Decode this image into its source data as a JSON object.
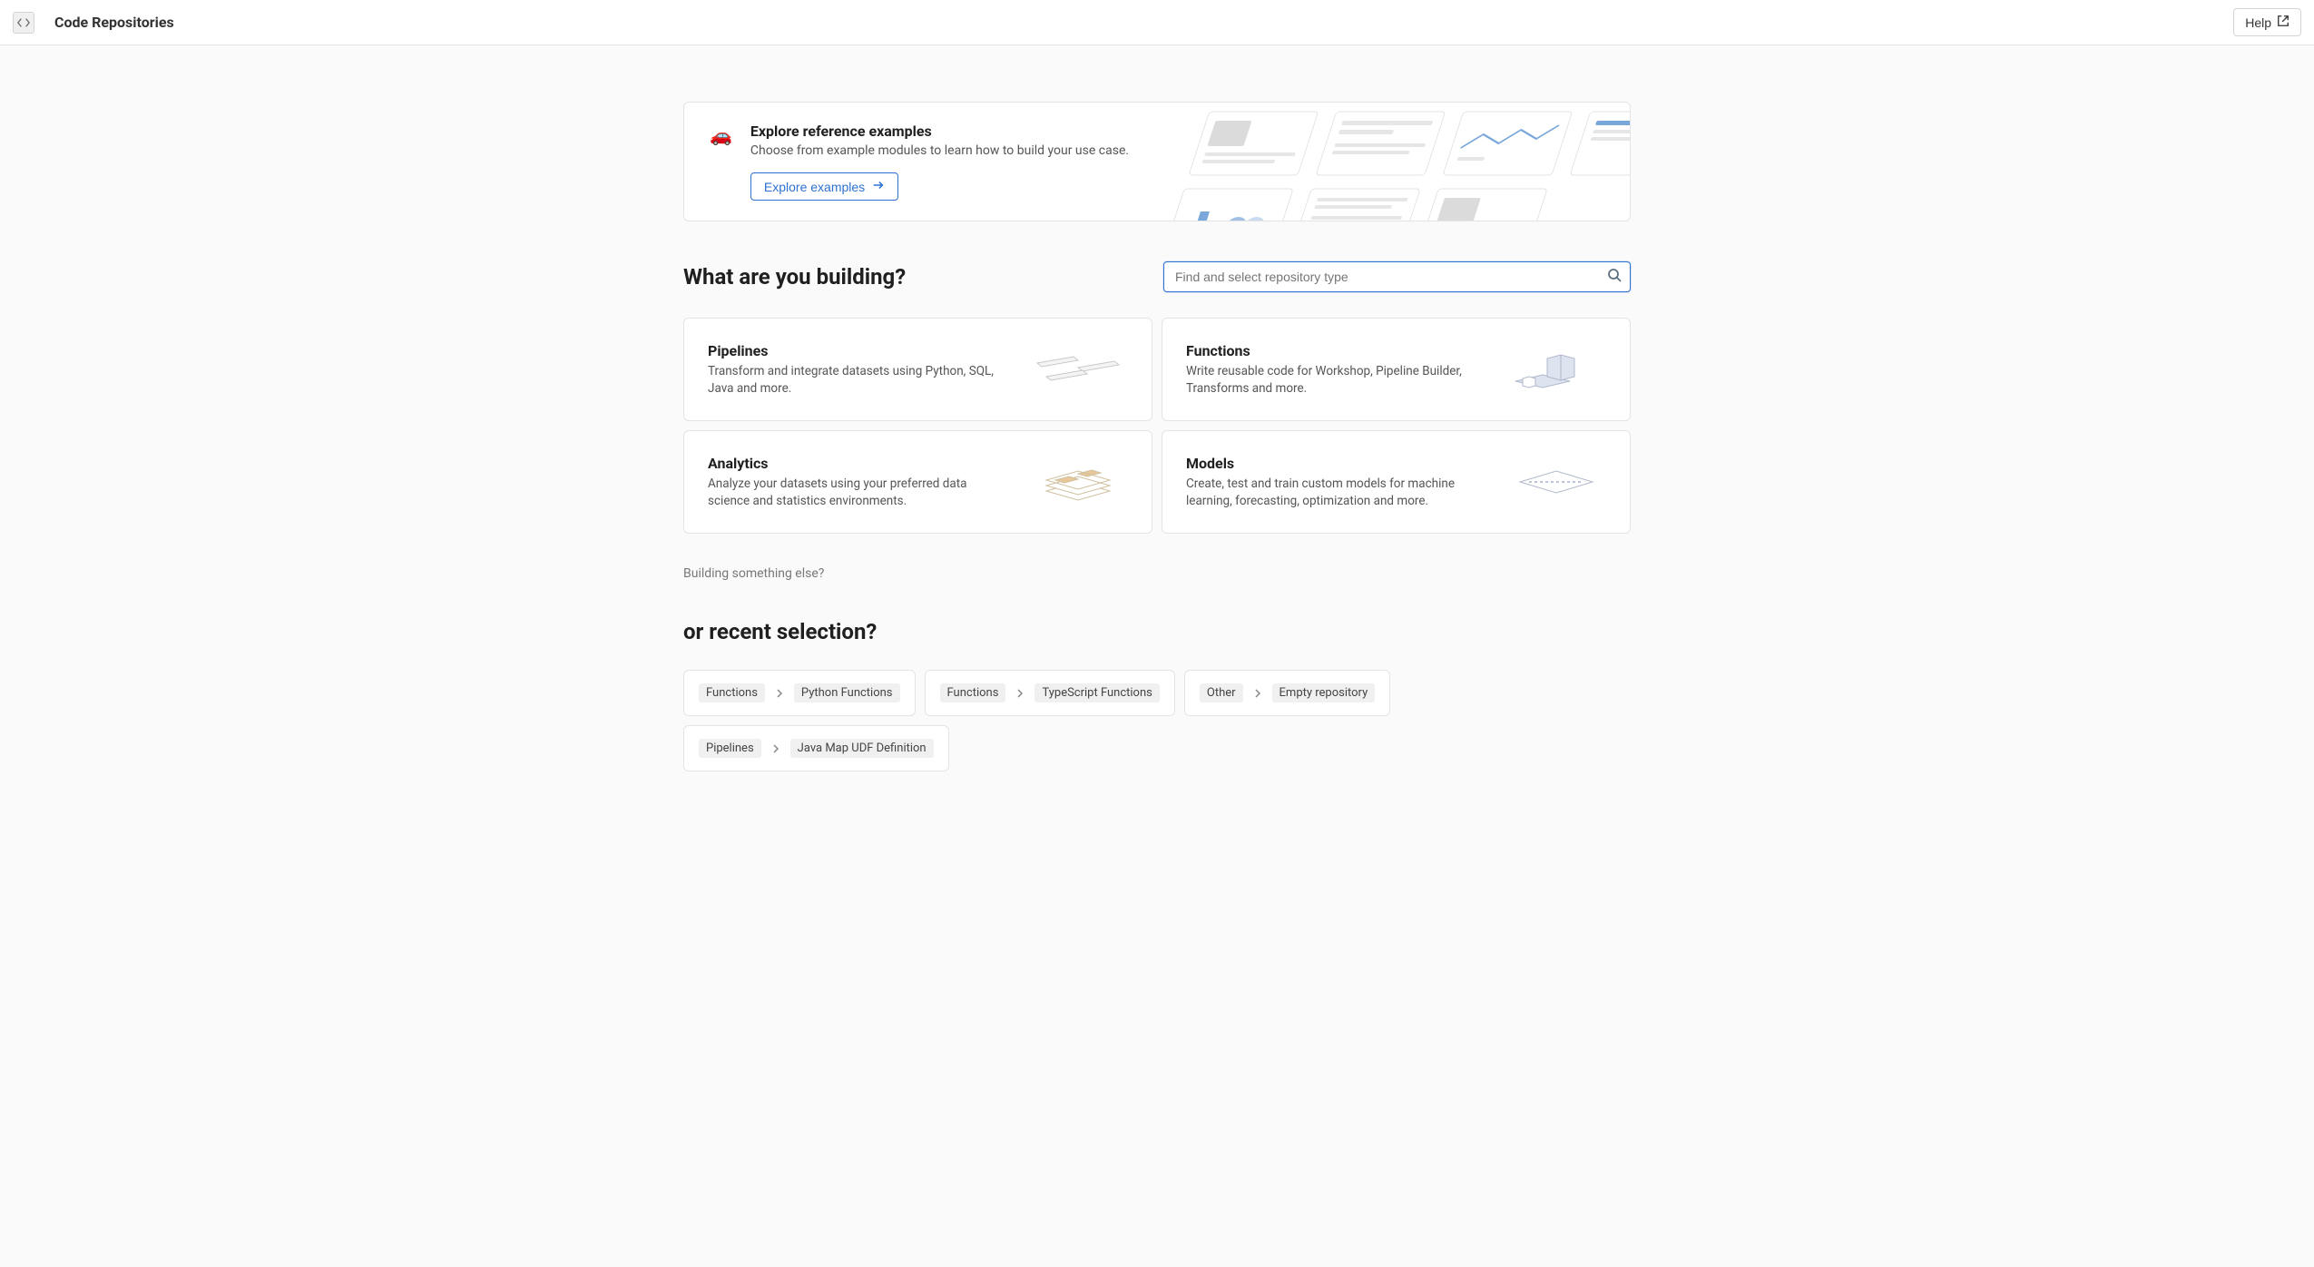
{
  "header": {
    "title": "Code Repositories",
    "help_label": "Help"
  },
  "banner": {
    "emoji": "🚗",
    "title": "Explore reference examples",
    "description": "Choose from example modules to learn how to build your use case.",
    "button_label": "Explore examples"
  },
  "building": {
    "heading": "What are you building?",
    "search_placeholder": "Find and select repository type"
  },
  "categories": [
    {
      "title": "Pipelines",
      "description": "Transform and integrate datasets using Python, SQL, Java and more."
    },
    {
      "title": "Functions",
      "description": "Write reusable code for Workshop, Pipeline Builder, Transforms and more."
    },
    {
      "title": "Analytics",
      "description": "Analyze your datasets using your preferred data science and statistics environments."
    },
    {
      "title": "Models",
      "description": "Create, test and train custom models for machine learning, forecasting, optimization and more."
    }
  ],
  "other_link": "Building something else?",
  "recent": {
    "heading": "or recent selection?",
    "items": [
      {
        "category": "Functions",
        "name": "Python Functions"
      },
      {
        "category": "Functions",
        "name": "TypeScript Functions"
      },
      {
        "category": "Other",
        "name": "Empty repository"
      },
      {
        "category": "Pipelines",
        "name": "Java Map UDF Definition"
      }
    ]
  }
}
